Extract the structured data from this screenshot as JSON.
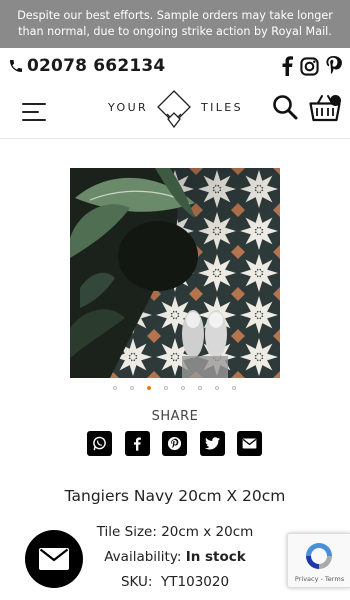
{
  "banner": {
    "line1": "Despite our best efforts. Sample orders may take longer",
    "line2": "than normal, due to ongoing strike action by Royal Mail."
  },
  "contact": {
    "phone": "02078 662134",
    "phone_icon": "phone-icon",
    "socials": [
      "facebook-icon",
      "instagram-icon",
      "pinterest-icon"
    ]
  },
  "header": {
    "logo_left": "YOUR",
    "logo_right": "TILES",
    "menu_icon": "hamburger-icon",
    "search_icon": "search-icon",
    "cart_icon": "basket-icon"
  },
  "gallery": {
    "slide_count": 8,
    "active_index": 2,
    "accent_color": "#e67e22"
  },
  "share": {
    "label": "SHARE",
    "buttons": [
      "whatsapp-icon",
      "facebook-icon",
      "pinterest-icon",
      "twitter-icon",
      "email-icon"
    ]
  },
  "product": {
    "title": "Tangiers Navy 20cm X 20cm",
    "tile_size_label": "Tile Size:",
    "tile_size_value": "20cm x 20cm",
    "availability_label": "Availability:",
    "availability_value": "In stock",
    "sku_label": "SKU:",
    "sku_value": "YT103020"
  },
  "widgets": {
    "chat_icon": "envelope-icon",
    "recaptcha_text": "Privacy - Terms"
  },
  "colors": {
    "banner_bg": "#8a8a8a",
    "tile_navy": "#2e3a3a",
    "tile_cream": "#eeebe4",
    "tile_terracotta": "#b5744e"
  }
}
